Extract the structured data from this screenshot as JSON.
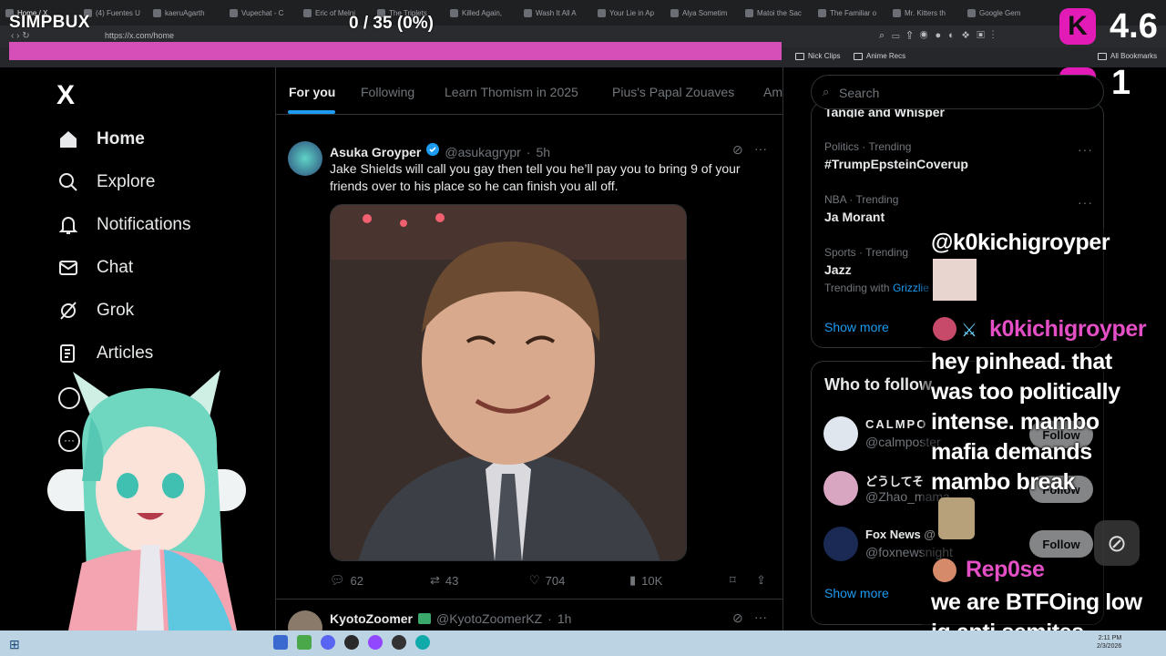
{
  "browser": {
    "tabs": [
      "Home / X",
      "(4) Fuentes U",
      "kaeruAgarth",
      "Vupechat - C",
      "Eric of Melni",
      "The Triplets",
      "Killed Again,",
      "Wash It All A",
      "Your Lie in Ap",
      "Alya Sometim",
      "Matoi the Sac",
      "The Familiar o",
      "Mr. Kitters th",
      "Google Gem"
    ],
    "url": "https://x.com/home",
    "bookmarks": [
      "Nick Clips",
      "Anime Recs",
      "All Bookmarks"
    ]
  },
  "overlay": {
    "brand": "SIMPBUX",
    "counter": "0 / 35 (0%)",
    "rating": "4.6",
    "viewer_count": "1",
    "accent_color": "#e21bb7"
  },
  "nav": {
    "logo": "X",
    "items": [
      {
        "label": "Home",
        "icon": "home-icon"
      },
      {
        "label": "Explore",
        "icon": "search-icon"
      },
      {
        "label": "Notifications",
        "icon": "bell-icon"
      },
      {
        "label": "Chat",
        "icon": "mail-icon"
      },
      {
        "label": "Grok",
        "icon": "grok-icon"
      },
      {
        "label": "Articles",
        "icon": "articles-icon"
      }
    ]
  },
  "feed": {
    "tabs": [
      "For you",
      "Following",
      "Learn Thomism in 2025",
      "Pius's Papal Zouaves",
      "Am"
    ],
    "active_tab": "For you",
    "post": {
      "name": "Asuka Groyper",
      "handle": "@asukagrypr",
      "time": "5h",
      "text": "Jake Shields will call you gay then tell you he’ll pay you to bring 9 of your friends over to his place so he can finish you all off.",
      "replies": "62",
      "reposts": "43",
      "likes": "704",
      "views": "10K"
    },
    "next_post": {
      "name": "KyotoZoomer",
      "handle": "@KyotoZoomerKZ",
      "time": "1h"
    }
  },
  "sidebar": {
    "search_placeholder": "Search",
    "trends_top_cut": "Tangle and Whisper",
    "trends": [
      {
        "meta": "Politics · Trending",
        "name": "#TrumpEpsteinCoverup"
      },
      {
        "meta": "NBA · Trending",
        "name": "Ja Morant"
      },
      {
        "meta": "Sports · Trending",
        "name": "Jazz",
        "extra": "Trending with",
        "extra_link": "Grizzlie"
      }
    ],
    "show_more": "Show more",
    "who_to_follow": "Who to follow",
    "follow_suggestions": [
      {
        "name": "CALMPO",
        "handle": "@calmposter",
        "button": "Follow"
      },
      {
        "name": "どうしてそ",
        "handle": "@Zhao_mama",
        "button": "Follow"
      },
      {
        "name": "Fox News @",
        "handle": "@foxnewsnight",
        "button": "Follow"
      }
    ],
    "show_more_2": "Show more"
  },
  "chat": [
    {
      "user": "@k0kichigroyper",
      "text": ""
    },
    {
      "user": "k0kichigroyper",
      "text": "hey pinhead. that was too politically intense. mambo mafia demands mambo break"
    },
    {
      "user": "Rep0se",
      "text": "we are BTFOing low iq anti semites"
    }
  ],
  "taskbar": {
    "time": "2:11 PM",
    "date": "2/3/2026"
  }
}
